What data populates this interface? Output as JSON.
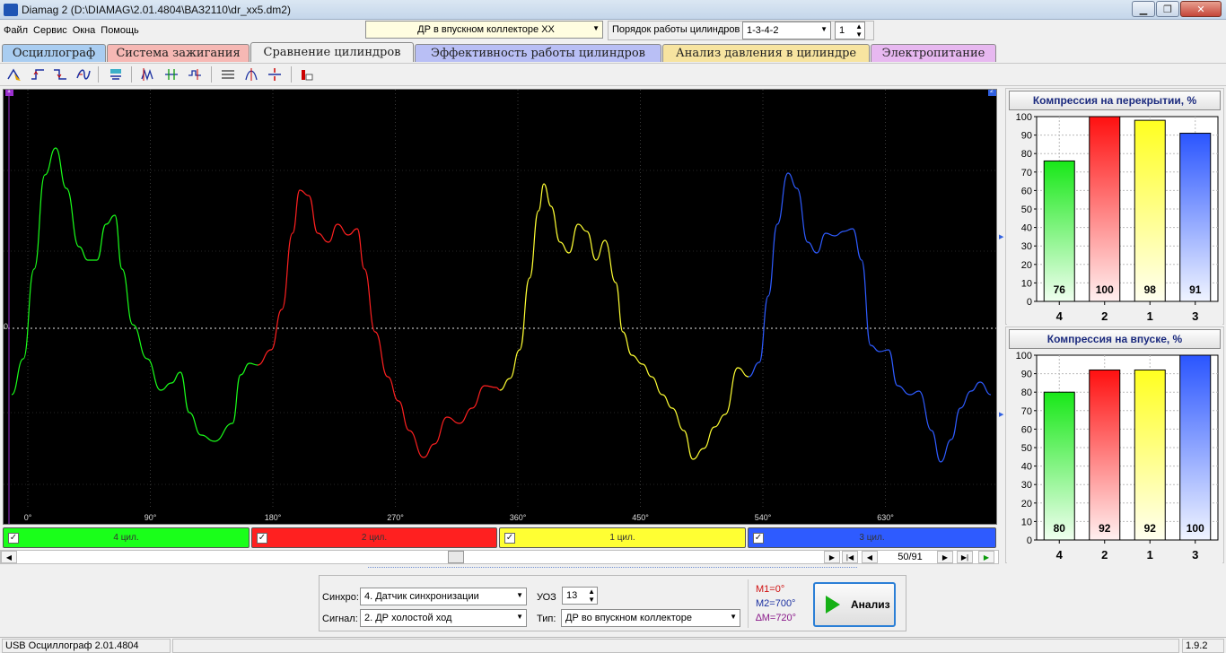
{
  "window": {
    "title": "Diamag 2 (D:\\DIAMAG\\2.01.4804\\ВАЗ2110\\dr_xx5.dm2)",
    "minimize": "▁",
    "restore": "❐",
    "close": "✕"
  },
  "menu": {
    "items": [
      "Файл",
      "Сервис",
      "Окна",
      "Помощь"
    ]
  },
  "top": {
    "signal_select": "ДР в впускном коллекторе ХХ",
    "firing_order_label": "Порядок работы цилиндров",
    "firing_order_value": "1-3-4-2",
    "cylinder_value": "1"
  },
  "tabs": [
    "Осциллограф",
    "Система зажигания",
    "Сравнение цилиндров",
    "Эффективность работы цилиндров",
    "Анализ давления в цилиндре",
    "Электропитание"
  ],
  "scope": {
    "x_ticks": [
      "0°",
      "90°",
      "180°",
      "270°",
      "360°",
      "450°",
      "540°",
      "630°"
    ],
    "zero_label": "0",
    "marker_left": "1",
    "marker_right": "2"
  },
  "cylinders": [
    {
      "label": "4 цил.",
      "color": "#1aff1a"
    },
    {
      "label": "2 цил.",
      "color": "#ff2020"
    },
    {
      "label": "1 цил.",
      "color": "#ffff33"
    },
    {
      "label": "3 цил.",
      "color": "#2e5bff"
    }
  ],
  "navigation": {
    "frame": "50/91"
  },
  "chart_data": [
    {
      "type": "bar",
      "title": "Компрессия на перекрытии, %",
      "categories": [
        "4",
        "2",
        "1",
        "3"
      ],
      "values": [
        76,
        100,
        98,
        91
      ],
      "ylim": [
        0,
        100
      ],
      "yticks": [
        "0",
        "10",
        "20",
        "30",
        "40",
        "50",
        "60",
        "70",
        "80",
        "90",
        "100"
      ],
      "grid": true
    },
    {
      "type": "bar",
      "title": "Компрессия на впуске, %",
      "categories": [
        "4",
        "2",
        "1",
        "3"
      ],
      "values": [
        80,
        92,
        92,
        100
      ],
      "ylim": [
        0,
        100
      ],
      "yticks": [
        "0",
        "10",
        "20",
        "30",
        "40",
        "50",
        "60",
        "70",
        "80",
        "90",
        "100"
      ],
      "grid": true
    }
  ],
  "controls": {
    "sync_label": "Синхро:",
    "sync_value": "4.  Датчик синхронизации",
    "signal_label": "Сигнал:",
    "signal_value": "2.  ДР холостой ход",
    "uoz_label": "УОЗ",
    "uoz_value": "13",
    "type_label": "Тип:",
    "type_value": "ДР во впускном коллекторе",
    "m1": "M1=0°",
    "m2": "M2=700°",
    "dm": "∆M=720°",
    "analyze": "Анализ"
  },
  "status": {
    "device": "USB Осциллограф  2.01.4804",
    "version": "1.9.2"
  },
  "colors": {
    "green": "#1aff1a",
    "red": "#ff2020",
    "yellow": "#ffff33",
    "blue": "#2e5bff"
  }
}
